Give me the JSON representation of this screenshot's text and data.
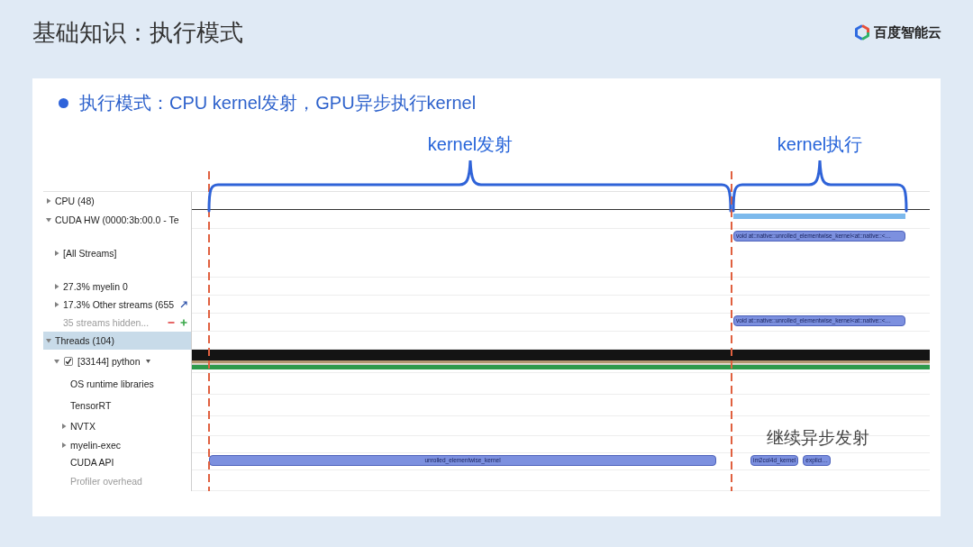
{
  "slide": {
    "title": "基础知识：执行模式",
    "logo": "百度智能云"
  },
  "bullet": {
    "text": "执行模式：CPU kernel发射，GPU异步执行kernel"
  },
  "annotations": [
    {
      "label": "kernel发射",
      "kind": "launch"
    },
    {
      "label": "kernel执行",
      "kind": "exec"
    }
  ],
  "note": {
    "text": "继续异步发射"
  },
  "tree": [
    {
      "label": "CPU (48)",
      "kind": "track",
      "expanded": false,
      "selected": false,
      "dimmed": false
    },
    {
      "label": "CUDA HW (0000:3b:00.0 - Te",
      "kind": "track",
      "expanded": true,
      "selected": false,
      "dimmed": false,
      "bars": [
        {
          "kind": "usage"
        }
      ],
      "children": [
        {
          "label": "[All Streams]",
          "kind": "track",
          "expanded": false,
          "selected": false,
          "dimmed": false,
          "bars": [
            {
              "kind": "exec",
              "label": "void at::native::unrolled_elementwise_kernel<at::native::<…"
            }
          ]
        },
        {
          "label": "27.3% myelin 0",
          "kind": "track",
          "expanded": false,
          "selected": false,
          "dimmed": false
        },
        {
          "label": "17.3% Other streams (655",
          "kind": "summary",
          "expanded": false,
          "selected": false,
          "dimmed": false
        },
        {
          "label": "35 streams hidden...",
          "kind": "hidden",
          "selected": false,
          "dimmed": true,
          "bars": [
            {
              "kind": "exec",
              "label": "void at::native::unrolled_elementwise_kernel<at::native::<…"
            }
          ]
        }
      ]
    },
    {
      "label": "Threads (104)",
      "kind": "track",
      "expanded": true,
      "selected": true,
      "dimmed": false,
      "children": [
        {
          "label": "[33144] python",
          "kind": "process",
          "expanded": true,
          "checked": true,
          "selected": false,
          "dimmed": false,
          "bars": [
            {
              "kind": "activity"
            }
          ],
          "children": [
            {
              "label": "OS runtime libraries",
              "kind": "track",
              "selected": false,
              "dimmed": false
            },
            {
              "label": "TensorRT",
              "kind": "track",
              "selected": false,
              "dimmed": false
            },
            {
              "label": "NVTX",
              "kind": "track",
              "expanded": false,
              "selected": false,
              "dimmed": false
            },
            {
              "label": "myelin-exec",
              "kind": "track",
              "expanded": false,
              "selected": false,
              "dimmed": false
            },
            {
              "label": "CUDA API",
              "kind": "track",
              "selected": false,
              "dimmed": false,
              "bars": [
                {
                  "kind": "launch",
                  "label": "unrolled_elementwise_kernel"
                },
                {
                  "kind": "exec",
                  "label": "im2col4d_kernel"
                },
                {
                  "kind": "exec",
                  "label": "explici…"
                }
              ]
            },
            {
              "label": "Profiler overhead",
              "kind": "track",
              "selected": false,
              "dimmed": true
            }
          ]
        }
      ]
    }
  ]
}
